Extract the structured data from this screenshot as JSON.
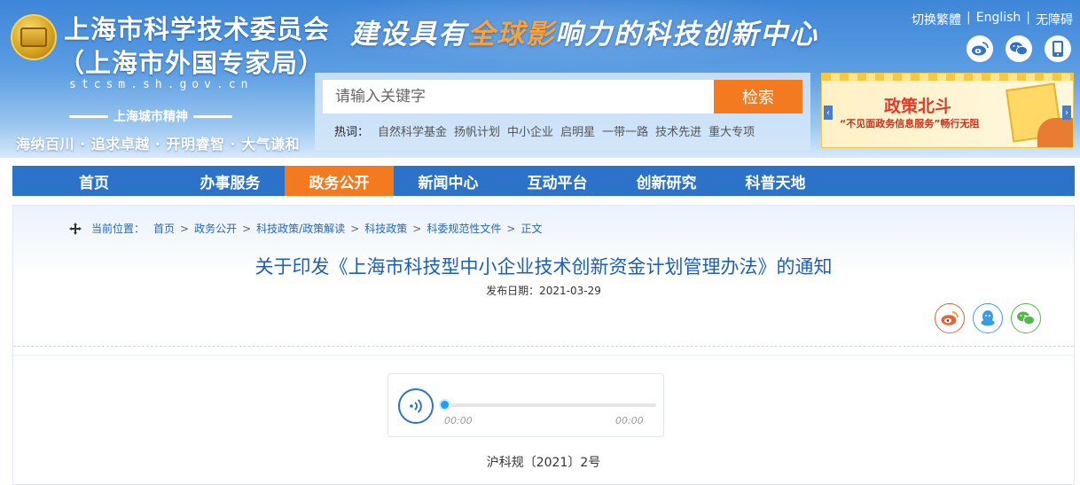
{
  "header": {
    "org_name": "上海市科学技术委员会",
    "org_name_2": "（上海市外国专家局）",
    "domain": "stcsm.sh.gov.cn",
    "spirit_title": "上海城市精神",
    "spirit_text": "海纳百川 · 追求卓越 · 开明睿智 · 大气谦和",
    "slogan_pre": "建设具有",
    "slogan_hl": "全球影",
    "slogan_post": "响力的科技创新中心",
    "top_links": [
      "切换繁體",
      "English",
      "无障碍"
    ],
    "top_link_sep": "|",
    "social_icons": [
      "weibo-icon",
      "wechat-icon",
      "mobile-icon"
    ]
  },
  "search": {
    "placeholder": "请输入关键字",
    "button": "检索",
    "hot_label": "热词：",
    "hot_words": [
      "自然科学基金",
      "扬帆计划",
      "中小企业",
      "启明星",
      "一带一路",
      "技术先进",
      "重大专项"
    ]
  },
  "banner": {
    "title": "政策北斗",
    "subtitle": "“不见面政务信息服务”畅行无阻",
    "prev": "‹",
    "next": "›"
  },
  "nav": {
    "items": [
      "首页",
      "办事服务",
      "政务公开",
      "新闻中心",
      "互动平台",
      "创新研究",
      "科普天地"
    ],
    "active_index": 2
  },
  "breadcrumb": {
    "label": "当前位置：",
    "items": [
      "首页",
      "政务公开",
      "科技政策/政策解读",
      "科技政策",
      "科委规范性文件",
      "正文"
    ],
    "sep": ">"
  },
  "article": {
    "title": "关于印发《上海市科技型中小企业技术创新资金计划管理办法》的通知",
    "date_label": "发布日期：",
    "date": "2021-03-29",
    "doc_number": "沪科规〔2021〕2号"
  },
  "share": {
    "items": [
      "weibo-icon",
      "qq-icon",
      "wechat-icon"
    ],
    "colors": {
      "weibo": "#e8623a",
      "qq": "#3a9de0",
      "wechat": "#54b847"
    }
  },
  "audio": {
    "current_time": "00:00",
    "duration": "00:00",
    "progress": 0
  },
  "colors": {
    "brand_blue": "#2b72c8",
    "accent_orange": "#f47a1f",
    "title_blue": "#1f5fb3"
  }
}
